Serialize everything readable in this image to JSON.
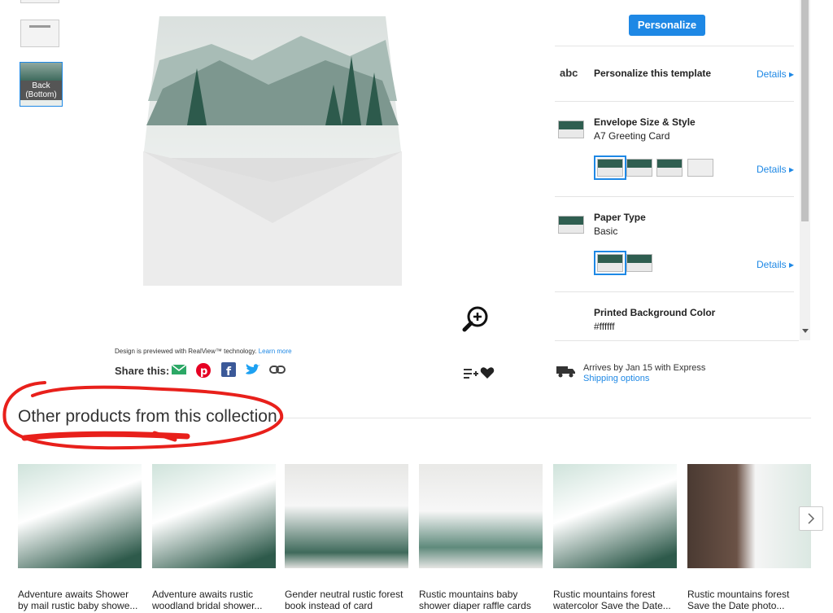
{
  "thumbnails": {
    "back_label": "Back (Bottom)"
  },
  "preview": {
    "realview_note": "Design is previewed with RealView™ technology.",
    "learn_more": "Learn more",
    "share_label": "Share this:"
  },
  "options": {
    "personalize_button": "Personalize",
    "abc_glyph": "abc",
    "personalize_template": "Personalize this template",
    "details": "Details",
    "envelope_title": "Envelope Size & Style",
    "envelope_value": "A7 Greeting Card",
    "paper_title": "Paper Type",
    "paper_value": "Basic",
    "bg_color_title": "Printed Background Color",
    "bg_color_value": "#ffffff"
  },
  "shipping": {
    "arrival": "Arrives by Jan 15 with Express",
    "options_link": "Shipping options"
  },
  "collection": {
    "heading": "Other products from this collection",
    "products": [
      {
        "title": "Adventure awaits Shower by mail rustic baby showe..."
      },
      {
        "title": "Adventure awaits rustic woodland bridal shower..."
      },
      {
        "title": "Gender neutral rustic forest book instead of card"
      },
      {
        "title": "Rustic mountains baby shower diaper raffle cards"
      },
      {
        "title": "Rustic mountains forest watercolor Save the Date..."
      },
      {
        "title": "Rustic mountains forest Save the Date photo..."
      }
    ]
  },
  "colors": {
    "accent": "#1e88e5",
    "annotation": "#e8201b"
  }
}
